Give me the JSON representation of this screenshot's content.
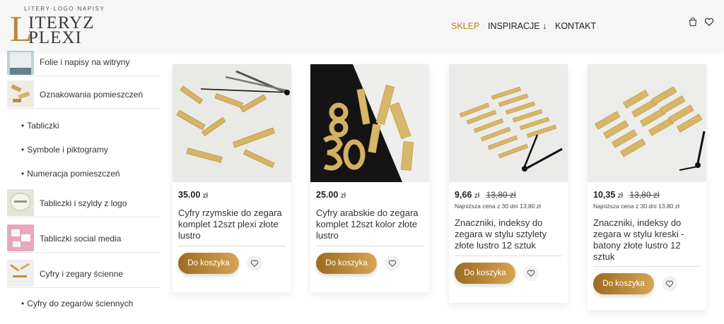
{
  "header": {
    "logo": {
      "tagline": "LITERY·LOGO·NAPISY",
      "letter": "L",
      "line1": "ITERYZ",
      "line2": "PLEXI"
    },
    "nav": [
      {
        "label": "SKLEP",
        "active": true
      },
      {
        "label": "INSPIRACJE ↓",
        "active": false
      },
      {
        "label": "KONTAKT",
        "active": false
      }
    ],
    "icons": [
      "cart-icon",
      "heart-icon"
    ]
  },
  "sidebar": {
    "categories": [
      {
        "label": "Folie i napisy na witryny"
      },
      {
        "label": "Oznakowania pomieszczeń"
      },
      {
        "label": "Tabliczki i szyldy z logo"
      },
      {
        "label": "Tabliczki social media"
      },
      {
        "label": "Cyfry i zegary ścienne"
      }
    ],
    "subitems": [
      {
        "label": "Tabliczki"
      },
      {
        "label": "Symbole i piktogramy"
      },
      {
        "label": "Numeracja pomieszczeń"
      },
      {
        "label": "Cyfry do zegarów ściennych"
      }
    ]
  },
  "products": [
    {
      "price": "35.00",
      "currency": "zł",
      "old_price": "",
      "lowest": "",
      "name": "Cyfry rzymskie do zegara komplet 12szt plexi złote lustro",
      "button": "Do koszyka"
    },
    {
      "price": "25.00",
      "currency": "zł",
      "old_price": "",
      "lowest": "",
      "name": "Cyfry arabskie do zegara komplet 12szt kolor złote lustro",
      "button": "Do koszyka"
    },
    {
      "price": "9,66",
      "currency": "zł",
      "old_price": "13,80 zł",
      "lowest": "Najniższa cena z 30 dni 13,80 zł",
      "name": "Znaczniki, indeksy do zegara w stylu sztylety złote lustro 12 sztuk",
      "button": "Do koszyka"
    },
    {
      "price": "10,35",
      "currency": "zł",
      "old_price": "13,80 zł",
      "lowest": "Najniższa cena z 30 dni 13,80 zł",
      "name": "Znaczniki, indeksy do zegara w stylu kreski - batony złote lustro 12 sztuk",
      "button": "Do koszyka"
    }
  ],
  "colors": {
    "accent": "#b5832b",
    "button_from": "#9c6b1f",
    "button_to": "#d6a555"
  }
}
